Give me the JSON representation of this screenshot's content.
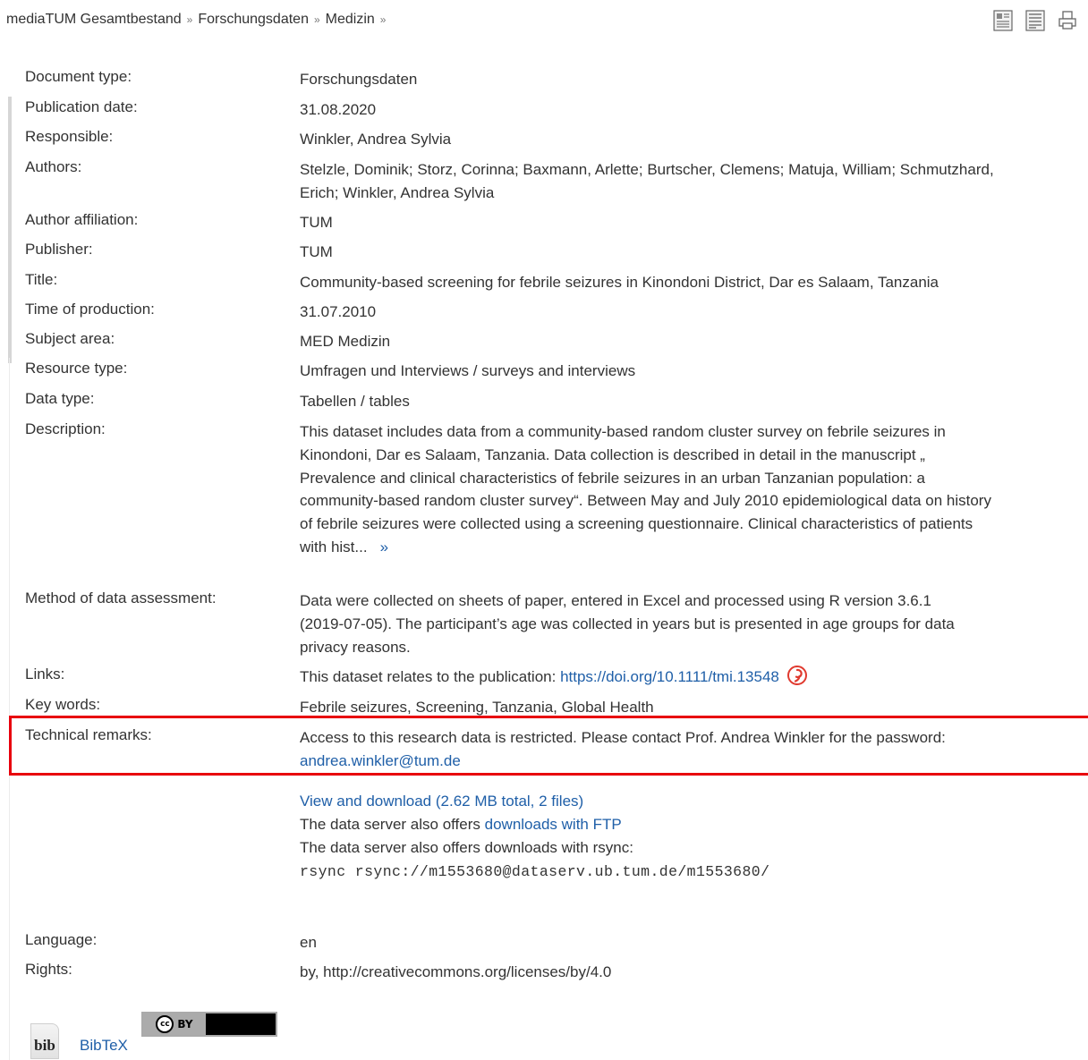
{
  "breadcrumb": [
    "mediaTUM Gesamtbestand",
    "Forschungsdaten",
    "Medizin"
  ],
  "breadcrumb_separator": "»",
  "toolbar_icons": [
    "detail-view-icon",
    "list-view-icon",
    "print-icon"
  ],
  "metadata": {
    "document_type": {
      "label": "Document type:",
      "value": "Forschungsdaten"
    },
    "publication_date": {
      "label": "Publication date:",
      "value": "31.08.2020"
    },
    "responsible": {
      "label": "Responsible:",
      "value": "Winkler, Andrea Sylvia"
    },
    "authors": {
      "label": "Authors:",
      "value_line1": "Stelzle, Dominik; Storz, Corinna; Baxmann, Arlette; Burtscher, Clemens; Matuja, William; Schmutzhard,",
      "value_line2": "Erich; Winkler, Andrea Sylvia"
    },
    "author_affiliation": {
      "label": "Author affiliation:",
      "value": "TUM"
    },
    "publisher": {
      "label": "Publisher:",
      "value": "TUM"
    },
    "title": {
      "label": "Title:",
      "value": "Community-based screening for febrile seizures in Kinondoni District, Dar es Salaam, Tanzania"
    },
    "time_of_production": {
      "label": "Time of production:",
      "value": "31.07.2010"
    },
    "subject_area": {
      "label": "Subject area:",
      "value": "MED Medizin"
    },
    "resource_type": {
      "label": "Resource type:",
      "value": "Umfragen und Interviews / surveys and interviews"
    },
    "data_type": {
      "label": "Data type:",
      "value": "Tabellen / tables"
    },
    "description": {
      "label": "Description:",
      "lines": [
        "This dataset includes data from a community-based random cluster survey on febrile seizures in",
        "Kinondoni, Dar es Salaam, Tanzania. Data collection is described in detail in the manuscript „",
        "Prevalence and clinical characteristics of febrile seizures in an urban Tanzanian population: a",
        "community-based random cluster survey“. Between May and July 2010 epidemiological data on history",
        "of febrile seizures were collected using a screening questionnaire. Clinical characteristics of patients",
        "with hist..."
      ],
      "more_link": "»"
    },
    "method": {
      "label": "Method of data assessment:",
      "lines": [
        "Data were collected on sheets of paper, entered in Excel and processed using R version 3.6.1",
        "(2019-07-05). The participant’s age was collected in years but is presented in age groups for data",
        "privacy reasons."
      ]
    },
    "links": {
      "label": "Links:",
      "prefix": "This dataset relates to the publication:",
      "url": "https://doi.org/10.1111/tmi.13548"
    },
    "key_words": {
      "label": "Key words:",
      "value": "Febrile seizures, Screening, Tanzania, Global Health"
    },
    "technical_remarks": {
      "label": "Technical remarks:",
      "line1": "Access to this research data is restricted. Please contact Prof. Andrea Winkler for the password:",
      "email": "andrea.winkler@tum.de"
    },
    "downloads": {
      "view_download": "View and download (2.62 MB total, 2 files)",
      "ftp_prefix": "The data server also offers",
      "ftp_link": "downloads with FTP",
      "rsync_text": "The data server also offers downloads with rsync:",
      "rsync_command": "rsync rsync://m1553680@dataserv.ub.tum.de/m1553680/"
    },
    "language": {
      "label": "Language:",
      "value": "en"
    },
    "rights": {
      "label": "Rights:",
      "value": "by, http://creativecommons.org/licenses/by/4.0"
    }
  },
  "license_badge": {
    "cc": "cc",
    "by": "BY"
  },
  "bibtex": {
    "icon_text": "bib",
    "link": "BibTeX"
  },
  "colors": {
    "link": "#1f5fa8",
    "highlight_border": "#e8000d",
    "text": "#333333"
  }
}
